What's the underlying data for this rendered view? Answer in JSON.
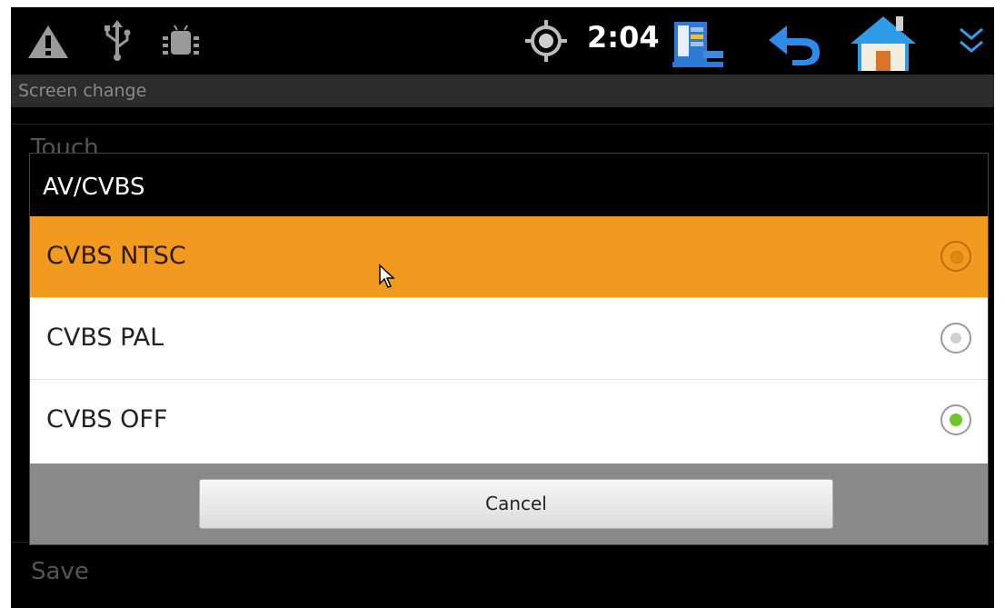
{
  "status_bar": {
    "time": "2:04",
    "icons": [
      "warning-icon",
      "usb-icon",
      "android-debug-icon",
      "gps-icon",
      "task-manager-icon",
      "back-icon",
      "home-icon",
      "expand-chevron-icon"
    ]
  },
  "settings": {
    "section_title": "Screen change",
    "items": [
      "Touch",
      "Save"
    ]
  },
  "dialog": {
    "title": "AV/CVBS",
    "options": [
      {
        "label": "CVBS NTSC",
        "checked": false,
        "pressed": true
      },
      {
        "label": "CVBS PAL",
        "checked": false,
        "pressed": false
      },
      {
        "label": "CVBS OFF",
        "checked": true,
        "pressed": false
      }
    ],
    "cancel_label": "Cancel"
  },
  "colors": {
    "highlight": "#f29a1f",
    "radio_checked": "#6fc629",
    "button_bar": "#898989"
  }
}
